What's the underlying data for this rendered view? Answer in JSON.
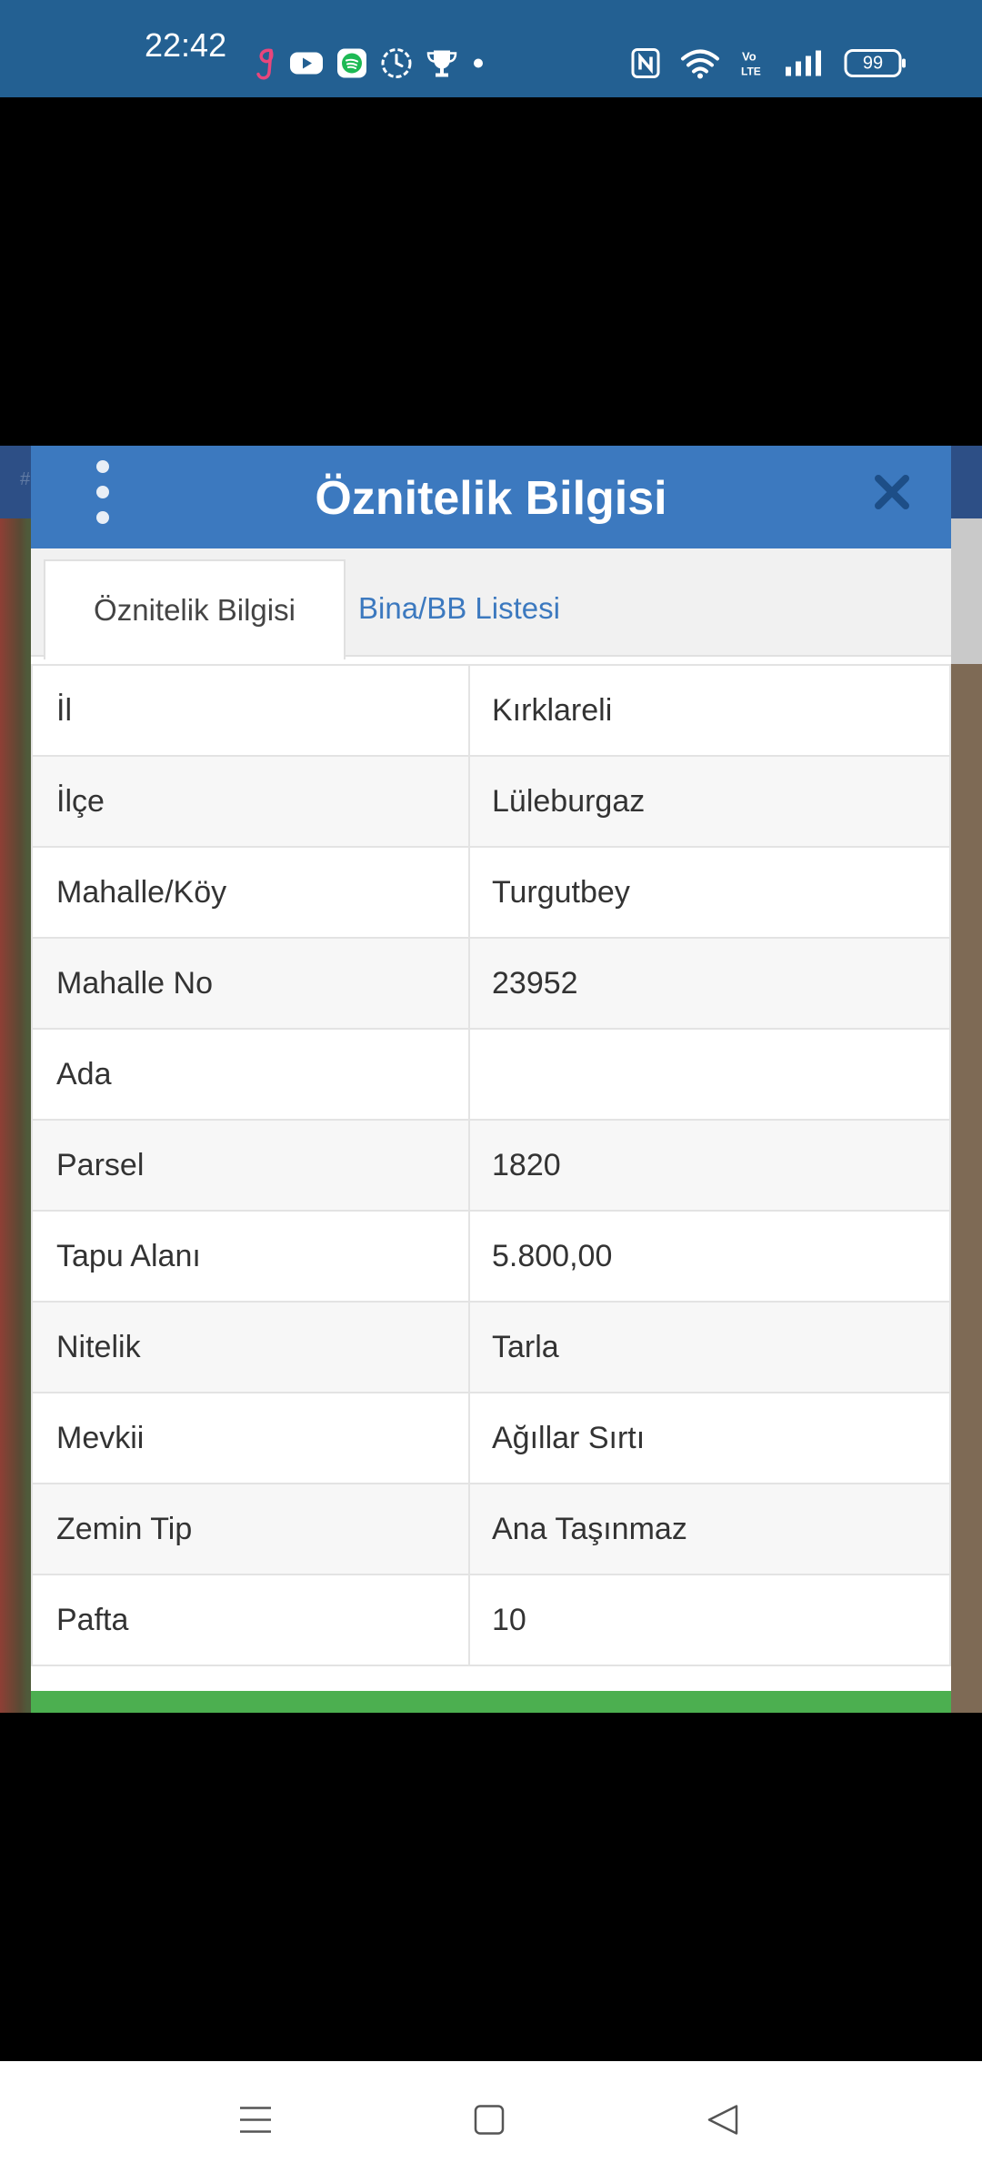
{
  "status_bar": {
    "time": "22:42",
    "battery": "99",
    "icons_left": [
      "g-app-icon",
      "youtube-icon",
      "spotify-icon",
      "clock-icon",
      "trophy-icon",
      "dot-icon"
    ],
    "icons_right": [
      "nfc-icon",
      "wifi-icon",
      "volte-icon",
      "signal-icon",
      "battery-icon"
    ]
  },
  "dialog": {
    "title": "Öznitelik Bilgisi",
    "tabs": [
      {
        "label": "Öznitelik Bilgisi",
        "active": true
      },
      {
        "label": "Bina/BB Listesi",
        "active": false
      }
    ],
    "rows": [
      {
        "key": "İl",
        "value": "Kırklareli"
      },
      {
        "key": "İlçe",
        "value": "Lüleburgaz"
      },
      {
        "key": "Mahalle/Köy",
        "value": "Turgutbey"
      },
      {
        "key": "Mahalle No",
        "value": "23952"
      },
      {
        "key": "Ada",
        "value": ""
      },
      {
        "key": "Parsel",
        "value": "1820"
      },
      {
        "key": "Tapu Alanı",
        "value": "5.800,00"
      },
      {
        "key": "Nitelik",
        "value": "Tarla"
      },
      {
        "key": "Mevkii",
        "value": "Ağıllar Sırtı"
      },
      {
        "key": "Zemin Tip",
        "value": "Ana Taşınmaz"
      },
      {
        "key": "Pafta",
        "value": "10"
      }
    ]
  },
  "background": {
    "ghost_id": "#11444 9547"
  },
  "nav_bar": {
    "buttons": [
      "menu-icon",
      "home-icon",
      "back-icon"
    ]
  },
  "colors": {
    "status_bar": "#236092",
    "dialog_header": "#3c79bf",
    "tab_link": "#3c79bf",
    "footer_bar": "#4caf50"
  }
}
